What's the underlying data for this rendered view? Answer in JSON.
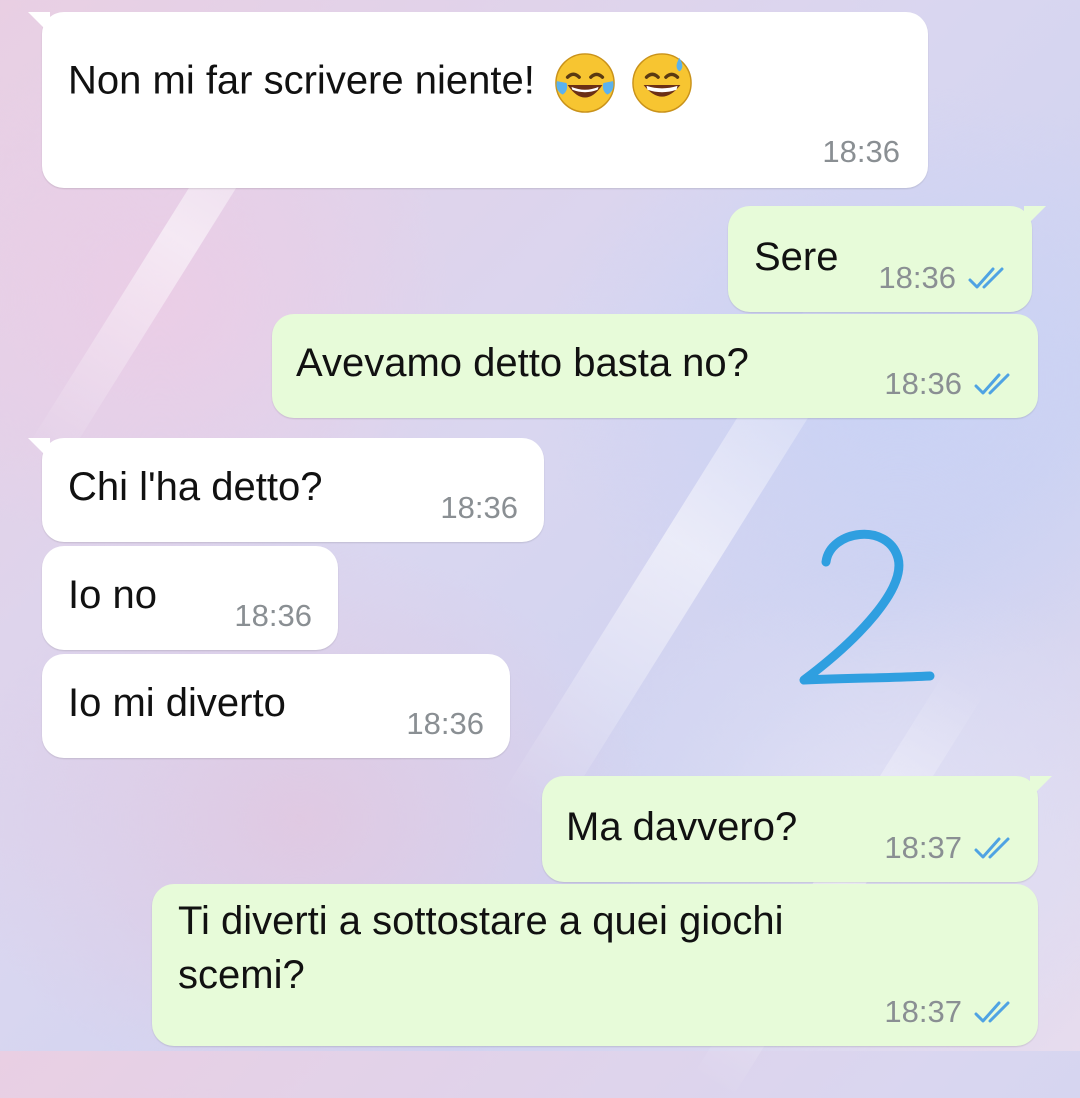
{
  "chat": {
    "messages": [
      {
        "direction": "in",
        "text": "Non mi far scrivere niente!",
        "emoji": [
          "face-with-tears-of-joy",
          "grinning-face-with-sweat"
        ],
        "time": "18:36"
      },
      {
        "direction": "out",
        "text": "Sere",
        "time": "18:36",
        "status": "read"
      },
      {
        "direction": "out",
        "text": "Avevamo detto basta no?",
        "time": "18:36",
        "status": "read"
      },
      {
        "direction": "in",
        "text": "Chi l'ha detto?",
        "time": "18:36"
      },
      {
        "direction": "in",
        "text": "Io no",
        "time": "18:36"
      },
      {
        "direction": "in",
        "text": "Io mi diverto",
        "time": "18:36"
      },
      {
        "direction": "out",
        "text": "Ma davvero?",
        "time": "18:37",
        "status": "read"
      },
      {
        "direction": "out",
        "text_line1": "Ti diverti a sottostare a quei giochi",
        "text_line2": "scemi?",
        "time": "18:37",
        "status": "read"
      }
    ]
  },
  "annotation": {
    "text": "2",
    "color": "#2f9fe0"
  },
  "colors": {
    "incoming_bubble": "#ffffff",
    "outgoing_bubble": "#e7fbd9",
    "timestamp": "#8a8f93",
    "read_ticks": "#4fa3e3"
  }
}
